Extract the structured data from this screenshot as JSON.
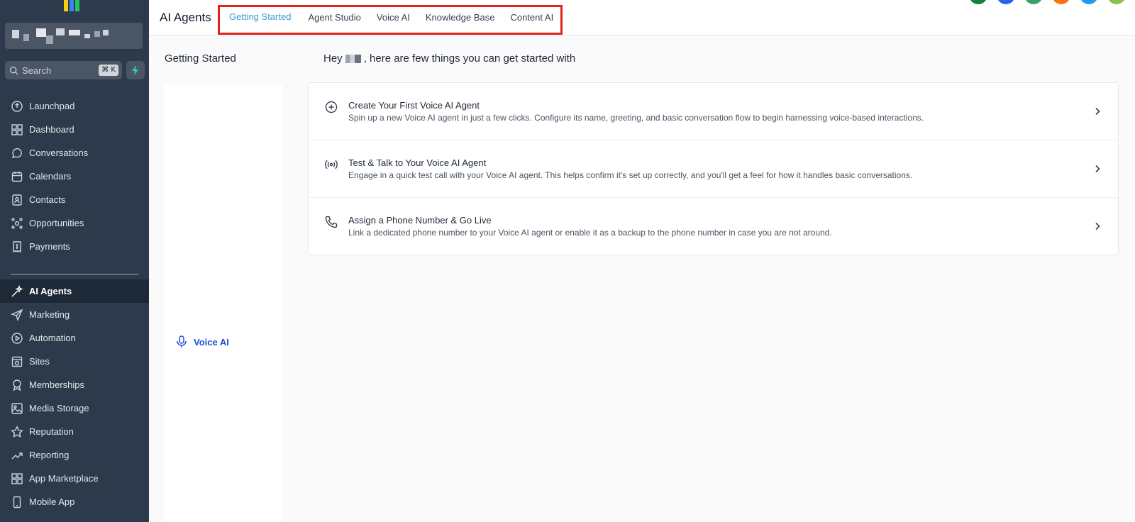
{
  "sidebar": {
    "search": {
      "placeholder": "Search",
      "shortcut": "⌘ K"
    },
    "nav_top": [
      {
        "label": "Launchpad",
        "icon": "rocket-icon"
      },
      {
        "label": "Dashboard",
        "icon": "dashboard-icon"
      },
      {
        "label": "Conversations",
        "icon": "chat-icon"
      },
      {
        "label": "Calendars",
        "icon": "calendar-icon"
      },
      {
        "label": "Contacts",
        "icon": "contacts-icon"
      },
      {
        "label": "Opportunities",
        "icon": "opportunities-icon"
      },
      {
        "label": "Payments",
        "icon": "payments-icon"
      }
    ],
    "nav_bottom": [
      {
        "label": "AI Agents",
        "icon": "sparkle-icon",
        "active": true
      },
      {
        "label": "Marketing",
        "icon": "send-icon"
      },
      {
        "label": "Automation",
        "icon": "automation-icon"
      },
      {
        "label": "Sites",
        "icon": "sites-icon"
      },
      {
        "label": "Memberships",
        "icon": "badge-icon"
      },
      {
        "label": "Media Storage",
        "icon": "image-icon"
      },
      {
        "label": "Reputation",
        "icon": "star-icon"
      },
      {
        "label": "Reporting",
        "icon": "trend-icon"
      },
      {
        "label": "App Marketplace",
        "icon": "grid-icon"
      },
      {
        "label": "Mobile App",
        "icon": "mobile-icon"
      }
    ]
  },
  "header": {
    "title": "AI Agents",
    "tabs": [
      {
        "label": "Getting Started",
        "active": true
      },
      {
        "label": "Agent Studio"
      },
      {
        "label": "Voice AI"
      },
      {
        "label": "Knowledge Base"
      },
      {
        "label": "Content AI"
      }
    ]
  },
  "left_panel": {
    "title": "Getting Started",
    "link": "Voice AI"
  },
  "main": {
    "greeting_prefix": "Hey",
    "greeting_suffix": ", here are few things you can get started with",
    "cards": [
      {
        "icon": "plus-circle-icon",
        "title": "Create Your First Voice AI Agent",
        "description": "Spin up a new Voice AI agent in just a few clicks. Configure its name, greeting, and basic conversation flow to begin harnessing voice-based interactions."
      },
      {
        "icon": "broadcast-icon",
        "title": "Test & Talk to Your Voice AI Agent",
        "description": "Engage in a quick test call with your Voice AI agent. This helps confirm it's set up correctly, and you'll get a feel for how it handles basic conversations."
      },
      {
        "icon": "phone-icon",
        "title": "Assign a Phone Number & Go Live",
        "description": "Link a dedicated phone number to your Voice AI agent or enable it as a backup to the phone number in case you are not around."
      }
    ]
  },
  "colors": {
    "sidebar_bg": "#2d3a4b",
    "accent": "#3b9ad9",
    "link": "#1d4ed8",
    "highlight_border": "#e0241b"
  }
}
